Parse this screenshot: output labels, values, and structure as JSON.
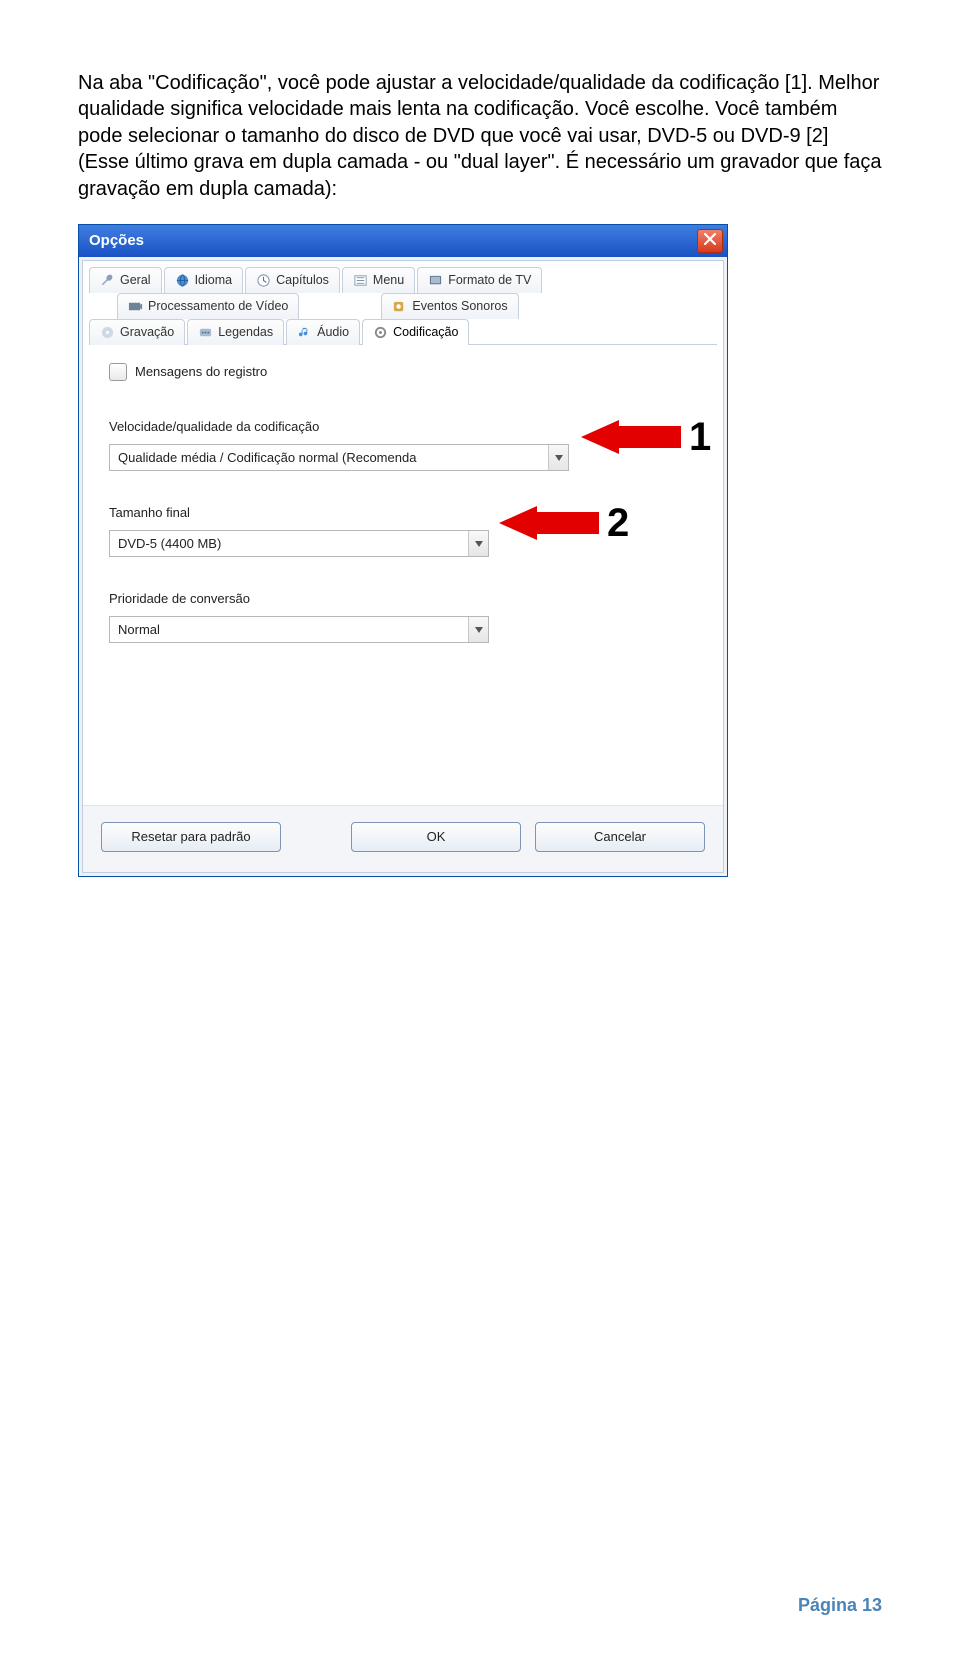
{
  "intro": "Na aba \"Codificação\", você pode ajustar a velocidade/qualidade da codificação [1]. Melhor qualidade significa velocidade mais lenta na codificação. Você escolhe. Você também pode selecionar o tamanho do disco de DVD que você vai usar, DVD-5 ou DVD-9 [2] (Esse último grava em dupla camada - ou \"dual layer\". É necessário um gravador que faça gravação em dupla camada):",
  "dialog": {
    "title": "Opções",
    "tabs_row1": [
      {
        "label": "Geral"
      },
      {
        "label": "Idioma"
      },
      {
        "label": "Capítulos"
      },
      {
        "label": "Menu"
      },
      {
        "label": "Formato de TV"
      }
    ],
    "tabs_row2": [
      {
        "label": "Processamento de Vídeo"
      },
      {
        "label": "Eventos Sonoros"
      }
    ],
    "tabs_row3": [
      {
        "label": "Gravação"
      },
      {
        "label": "Legendas"
      },
      {
        "label": "Áudio"
      },
      {
        "label": "Codificação"
      }
    ],
    "checkbox_label": "Mensagens do registro",
    "sect1_label": "Velocidade/qualidade da codificação",
    "sect1_value": "Qualidade média / Codificação normal (Recomenda",
    "sect2_label": "Tamanho final",
    "sect2_value": "DVD-5 (4400 MB)",
    "sect3_label": "Prioridade de conversão",
    "sect3_value": "Normal",
    "btn_reset": "Resetar para padrão",
    "btn_ok": "OK",
    "btn_cancel": "Cancelar"
  },
  "arrows": {
    "one": "1",
    "two": "2"
  },
  "footer": "Página 13"
}
